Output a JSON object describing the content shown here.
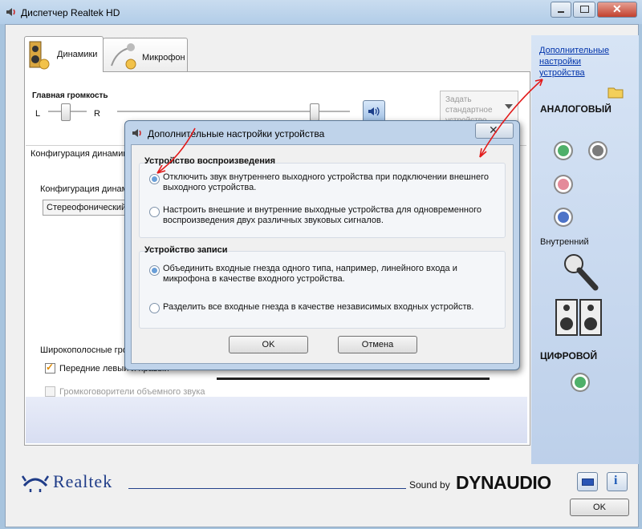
{
  "window": {
    "title": "Диспетчер Realtek HD",
    "ok_label": "OK"
  },
  "tabs": [
    {
      "label": "Динамики"
    },
    {
      "label": "Микрофон"
    }
  ],
  "volume": {
    "label": "Главная громкость",
    "left": "L",
    "right": "R"
  },
  "default_device": {
    "label": "Задать стандартное устройство"
  },
  "config": {
    "group_label": "Конфигурация динамиков",
    "inner_label": "Конфигурация динамиков",
    "select_value": "Стереофонический"
  },
  "fullrange": {
    "label": "Широкополосные громкоговорители",
    "front_lr": "Передние левый и правый",
    "surround": "Громкоговорители объемного звука"
  },
  "side": {
    "link": "Дополнительные настройки устройства",
    "analog": "АНАЛОГОВЫЙ",
    "internal": "Внутренний",
    "digital": "ЦИФРОВОЙ"
  },
  "footer": {
    "brand": "Realtek",
    "sound_by": "Sound by",
    "dynaudio": "DYNAUDIO"
  },
  "dialog": {
    "title": "Дополнительные настройки устройства",
    "playback": {
      "title": "Устройство воспроизведения",
      "opt1": "Отключить звук внутреннего выходного устройства при подключении внешнего выходного устройства.",
      "opt2": "Настроить внешние и внутренние выходные устройства для одновременного воспроизведения двух различных звуковых сигналов.",
      "selected": 1
    },
    "record": {
      "title": "Устройство записи",
      "opt1": "Объединить входные гнезда одного типа, например, линейного входа и микрофона в качестве входного устройства.",
      "opt2": "Разделить все входные гнезда в качестве независимых входных устройств.",
      "selected": 1
    },
    "ok": "OK",
    "cancel": "Отмена"
  },
  "colors": {
    "jack_green": "#4fb06a",
    "jack_grey": "#7b7b7b",
    "jack_pink": "#e48a9a",
    "jack_blue": "#4d73c8",
    "annotation_red": "#e21a1a",
    "link_blue": "#0033aa"
  },
  "icons": [
    "speaker-icon",
    "microphone-icon",
    "volume-icon",
    "folder-icon",
    "mic-icon",
    "speakers-icon",
    "info-icon",
    "battery-icon",
    "close-icon",
    "minimize-icon",
    "maximize-icon"
  ]
}
